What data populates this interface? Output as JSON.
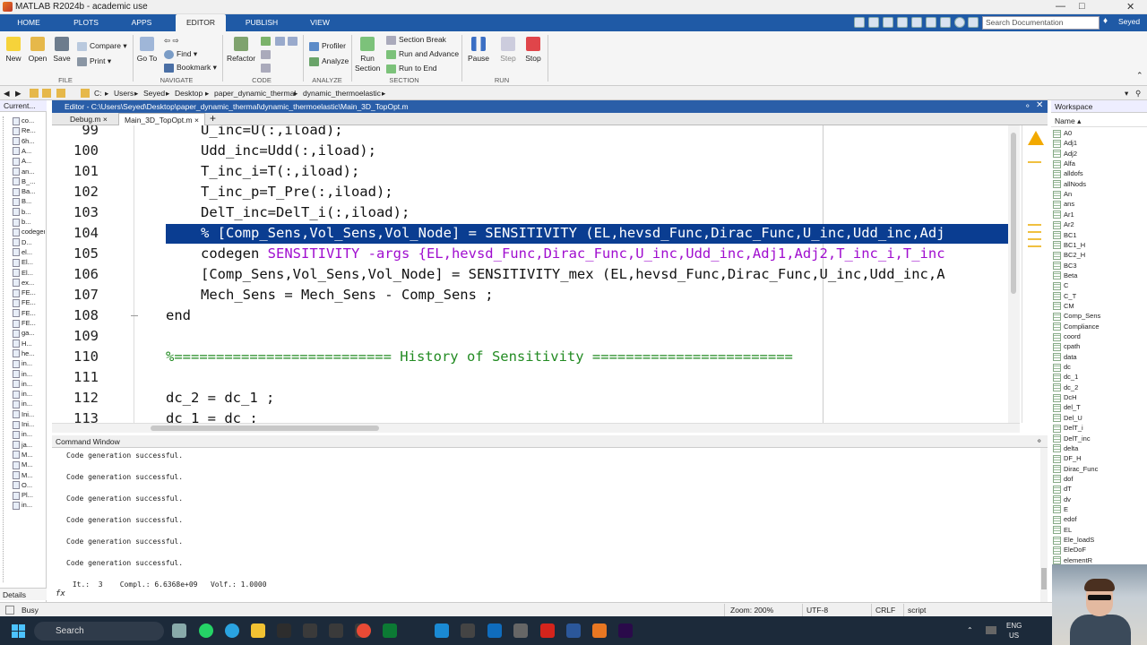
{
  "window": {
    "title": "MATLAB R2024b - academic use"
  },
  "ribbon": {
    "tabs": [
      "HOME",
      "PLOTS",
      "APPS",
      "EDITOR",
      "PUBLISH",
      "VIEW"
    ],
    "active_tab": "EDITOR",
    "search_placeholder": "Search Documentation",
    "user": "Seyed"
  },
  "toolstrip": {
    "file": {
      "new": "New",
      "open": "Open",
      "save": "Save",
      "compare": "Compare",
      "print": "Print",
      "section": "FILE"
    },
    "navigate": {
      "goto": "Go To",
      "find": "Find",
      "bookmark": "Bookmark",
      "section": "NAVIGATE"
    },
    "code": {
      "refactor": "Refactor",
      "section": "CODE"
    },
    "analyze": {
      "profiler": "Profiler",
      "analyze": "Analyze",
      "section": "ANALYZE"
    },
    "section_grp": {
      "run_section": "Run Section",
      "section_break": "Section Break",
      "run_and_advance": "Run and Advance",
      "run_to_end": "Run to End",
      "section": "SECTION"
    },
    "run": {
      "pause": "Pause",
      "step": "Step",
      "stop": "Stop",
      "section": "RUN"
    }
  },
  "address": {
    "path": [
      "C:",
      "Users",
      "Seyed",
      "Desktop",
      "paper_dynamic_thermal",
      "dynamic_thermoelastic"
    ]
  },
  "left_panel": {
    "header": "Current...",
    "files": [
      "co...",
      "Re...",
      "6h...",
      "A...",
      "A...",
      "an...",
      "B_...",
      "Ba...",
      "B...",
      "b...",
      "b...",
      "codegen",
      "D...",
      "el...",
      "El...",
      "El...",
      "ex...",
      "FE...",
      "FE...",
      "FE...",
      "FE...",
      "ga...",
      "H...",
      "he...",
      "in...",
      "in...",
      "in...",
      "in...",
      "in...",
      "Ini...",
      "Ini...",
      "in...",
      "ja...",
      "M...",
      "M...",
      "M...",
      "O...",
      "Pl...",
      "in..."
    ],
    "details": "Details"
  },
  "editor": {
    "header": "Editor - C:\\Users\\Seyed\\Desktop\\paper_dynamic_thermal\\dynamic_thermoelastic\\Main_3D_TopOpt.m",
    "tabs": [
      "Debug.m",
      "Main_3D_TopOpt.m"
    ],
    "active_tab": "Main_3D_TopOpt.m",
    "lines": [
      {
        "num": "99",
        "text": "U_inc=U(:,iload);",
        "indent": 2
      },
      {
        "num": "100",
        "text": "Udd_inc=Udd(:,iload);",
        "indent": 2
      },
      {
        "num": "101",
        "text": "T_inc_i=T(:,iload);",
        "indent": 2
      },
      {
        "num": "102",
        "text": "T_inc_p=T_Pre(:,iload);",
        "indent": 2
      },
      {
        "num": "103",
        "text": "DelT_inc=DelT_i(:,iload);",
        "indent": 2
      },
      {
        "num": "104",
        "text": "% [Comp_Sens,Vol_Sens,Vol_Node] = SENSITIVITY (EL,hevsd_Func,Dirac_Func,U_inc,Udd_inc,Adj",
        "indent": 2
      },
      {
        "num": "105",
        "pre": "codegen ",
        "text": "SENSITIVITY -args {EL,hevsd_Func,Dirac_Func,U_inc,Udd_inc,Adj1,Adj2,T_inc_i,T_inc",
        "indent": 2
      },
      {
        "num": "106",
        "text": "[Comp_Sens,Vol_Sens,Vol_Node] = SENSITIVITY_mex (EL,hevsd_Func,Dirac_Func,U_inc,Udd_inc,A",
        "indent": 2
      },
      {
        "num": "107",
        "text": "Mech_Sens = Mech_Sens - Comp_Sens ;",
        "indent": 2
      },
      {
        "num": "108",
        "text": "end",
        "indent": 1
      },
      {
        "num": "109",
        "text": "",
        "indent": 0
      },
      {
        "num": "110",
        "text": "%========================== History of Sensitivity ========================",
        "indent": 1
      },
      {
        "num": "111",
        "text": "",
        "indent": 0
      },
      {
        "num": "112",
        "text": "dc_2 = dc_1 ;",
        "indent": 1
      },
      {
        "num": "113",
        "text": "dc_1 = dc ;",
        "indent": 1
      }
    ]
  },
  "command_window": {
    "header": "Command Window",
    "lines": [
      "Code generation successful.",
      "Code generation successful.",
      "Code generation successful.",
      "Code generation successful.",
      "Code generation successful.",
      "Code generation successful.",
      " It.:  3    Compl.: 6.6368e+09   Volf.: 1.0000"
    ],
    "prompt": "fx"
  },
  "workspace": {
    "header": "Workspace",
    "column": "Name",
    "vars": [
      "A0",
      "Adj1",
      "Adj2",
      "Alfa",
      "alldofs",
      "allNods",
      "An",
      "ans",
      "Ar1",
      "Ar2",
      "BC1",
      "BC1_H",
      "BC2_H",
      "BC3",
      "Beta",
      "C",
      "C_T",
      "CM",
      "Comp_Sens",
      "Compliance",
      "coord",
      "cpath",
      "data",
      "dc",
      "dc_1",
      "dc_2",
      "DcH",
      "del_T",
      "Del_U",
      "DelT_i",
      "DelT_inc",
      "delta",
      "DF_H",
      "Dirac_Func",
      "dof",
      "dT",
      "dv",
      "E",
      "edof",
      "EL",
      "Ele_loadS",
      "EleDoF",
      "elementR"
    ]
  },
  "status": {
    "left": "Busy",
    "zoom": "Zoom: 200%",
    "encoding": "UTF-8",
    "eol": "CRLF",
    "mode": "script"
  },
  "taskbar": {
    "search": "Search",
    "lang": "ENG",
    "region": "US"
  },
  "colors": {
    "ribbon": "#1f5aa6",
    "highlight": "#0a3d91",
    "comment": "#228b22",
    "string": "#a00ecf"
  }
}
